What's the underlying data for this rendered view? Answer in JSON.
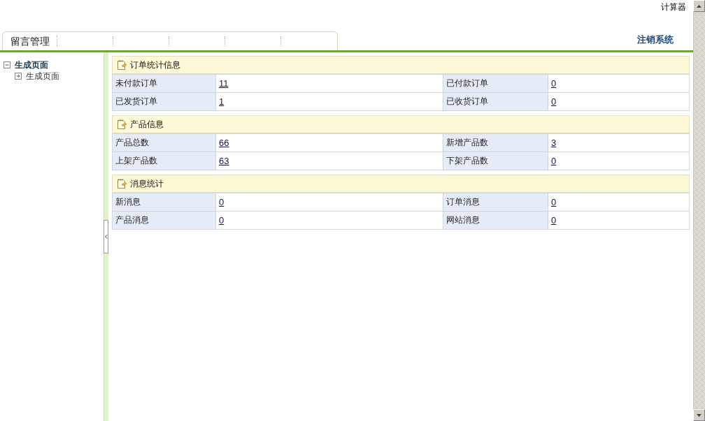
{
  "top_link": "计算器",
  "nav_tabs": [
    {
      "label": "留言管理"
    }
  ],
  "logout": "注销系统",
  "sidebar": {
    "items": [
      {
        "label": "生成页面",
        "expanded": true,
        "children": [
          {
            "label": "生成页面"
          }
        ]
      }
    ]
  },
  "sections": [
    {
      "title": "订单统计信息",
      "rows": [
        [
          {
            "label": "未付款订单",
            "value": "11"
          },
          {
            "label": "已付款订单",
            "value": "0"
          }
        ],
        [
          {
            "label": "已发货订单",
            "value": "1"
          },
          {
            "label": "已收货订单",
            "value": "0"
          }
        ]
      ]
    },
    {
      "title": "产品信息",
      "rows": [
        [
          {
            "label": "产品总数",
            "value": "66"
          },
          {
            "label": "新增产品数",
            "value": "3"
          }
        ],
        [
          {
            "label": "上架产品数",
            "value": "63"
          },
          {
            "label": "下架产品数",
            "value": "0"
          }
        ]
      ]
    },
    {
      "title": "消息统计",
      "rows": [
        [
          {
            "label": "新消息",
            "value": "0"
          },
          {
            "label": "订单消息",
            "value": "0"
          }
        ],
        [
          {
            "label": "产品消息",
            "value": "0"
          },
          {
            "label": "网站消息",
            "value": "0"
          }
        ]
      ]
    }
  ]
}
